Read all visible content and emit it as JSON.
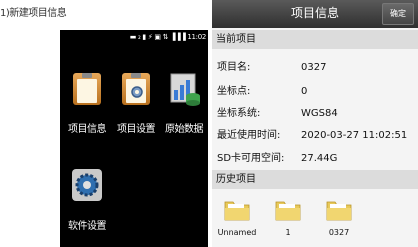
{
  "caption": "1)新建项目信息",
  "left": {
    "status_text": "▬₂₆ᴳ ▮▮ ⚡ ▣ ↑↓ᴵᴳ ▐▐▐ 11:02",
    "tiles": [
      {
        "label": "项目信息",
        "icon": "clipboard-icon"
      },
      {
        "label": "项目设置",
        "icon": "clipboard-settings-icon"
      },
      {
        "label": "原始数据",
        "icon": "data-chart-icon"
      },
      {
        "label": "软件设置",
        "icon": "gear-icon"
      }
    ]
  },
  "right": {
    "title": "项目信息",
    "confirm_label": "确定",
    "current_section": "当前项目",
    "fields": [
      {
        "key": "项目名:",
        "value": "0327"
      },
      {
        "key": "坐标点:",
        "value": "0"
      },
      {
        "key": "坐标系统:",
        "value": "WGS84"
      },
      {
        "key": "最近使用时间:",
        "value": "2020-03-27 11:02:51"
      },
      {
        "key": "SD卡可用空间:",
        "value": "27.44G"
      }
    ],
    "history_section": "历史项目",
    "history": [
      {
        "name": "Unnamed"
      },
      {
        "name": "1"
      },
      {
        "name": "0327"
      }
    ]
  }
}
